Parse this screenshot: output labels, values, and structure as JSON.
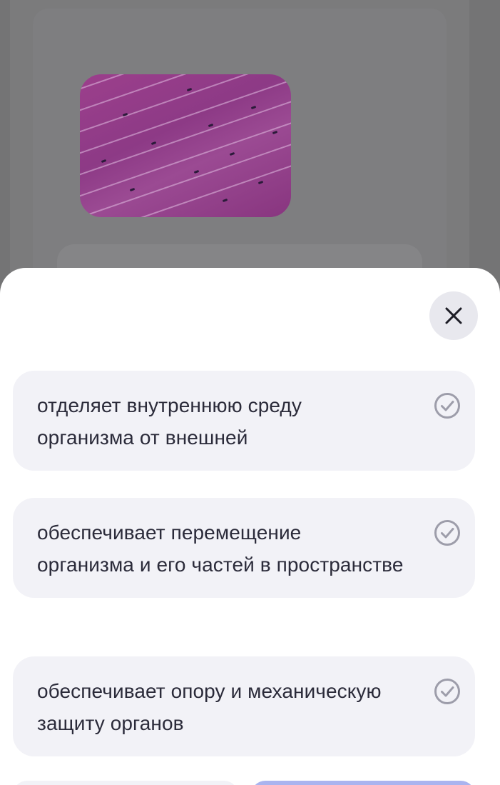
{
  "sheet": {
    "options": [
      {
        "text": "отделяет внутреннюю среду организма от внешней",
        "icon": "check-circle-icon"
      },
      {
        "text": "обеспечивает перемещение организма и его частей в пространстве",
        "icon": "check-circle-icon"
      },
      {
        "text": "обеспечивает опору и механическую защиту органов",
        "icon": "check-circle-icon"
      }
    ],
    "close_icon": "close-icon"
  },
  "colors": {
    "overlay": "#747475",
    "sheet": "#ffffff",
    "option_bg": "#f2f2f7",
    "text": "#2b2b3a",
    "check": "#9d9daa",
    "primary": "#aab4ef"
  },
  "background": {
    "image": "muscle-tissue-micrograph"
  }
}
